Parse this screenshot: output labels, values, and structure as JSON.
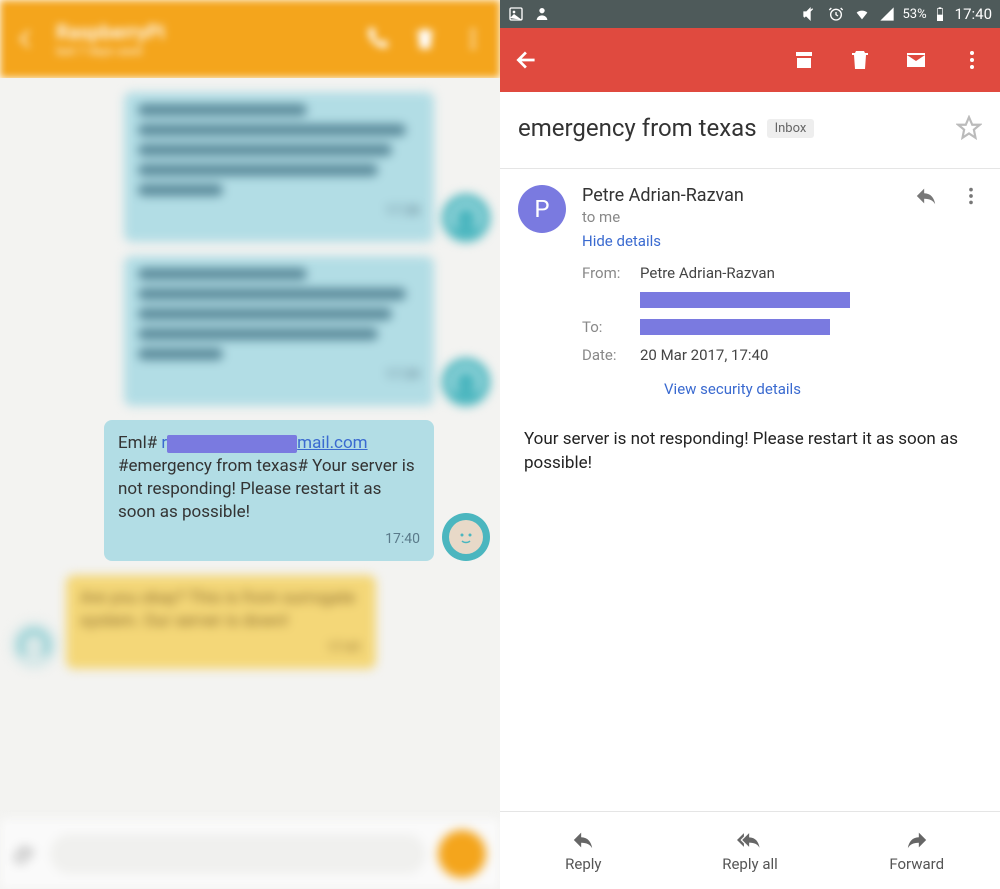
{
  "left": {
    "header": {
      "title": "RaspberryPi",
      "subtitle": "last 7 days used"
    },
    "focused_message": {
      "prefix": "Eml#",
      "email_visible_suffix": "mail.com",
      "body": "#emergency from texas# Your server is not responding! Please restart it as soon as possible!",
      "time": "17:40"
    },
    "yellow_blurb": "Are you okay? This is from surrogate system. Our server is down!"
  },
  "right": {
    "statusbar": {
      "battery_text": "53%",
      "time": "17:40"
    },
    "subject": "emergency from texas",
    "inbox_chip": "Inbox",
    "sender": {
      "initial": "P",
      "name": "Petre Adrian-Razvan",
      "to_line": "to me",
      "hide_details": "Hide details"
    },
    "details": {
      "from_label": "From:",
      "from_value": "Petre Adrian-Razvan",
      "to_label": "To:",
      "date_label": "Date:",
      "date_value": "20 Mar 2017, 17:40",
      "security_link": "View security details"
    },
    "body": "Your server is not responding! Please restart it as soon as possible!",
    "actions": {
      "reply": "Reply",
      "reply_all": "Reply all",
      "forward": "Forward"
    }
  }
}
